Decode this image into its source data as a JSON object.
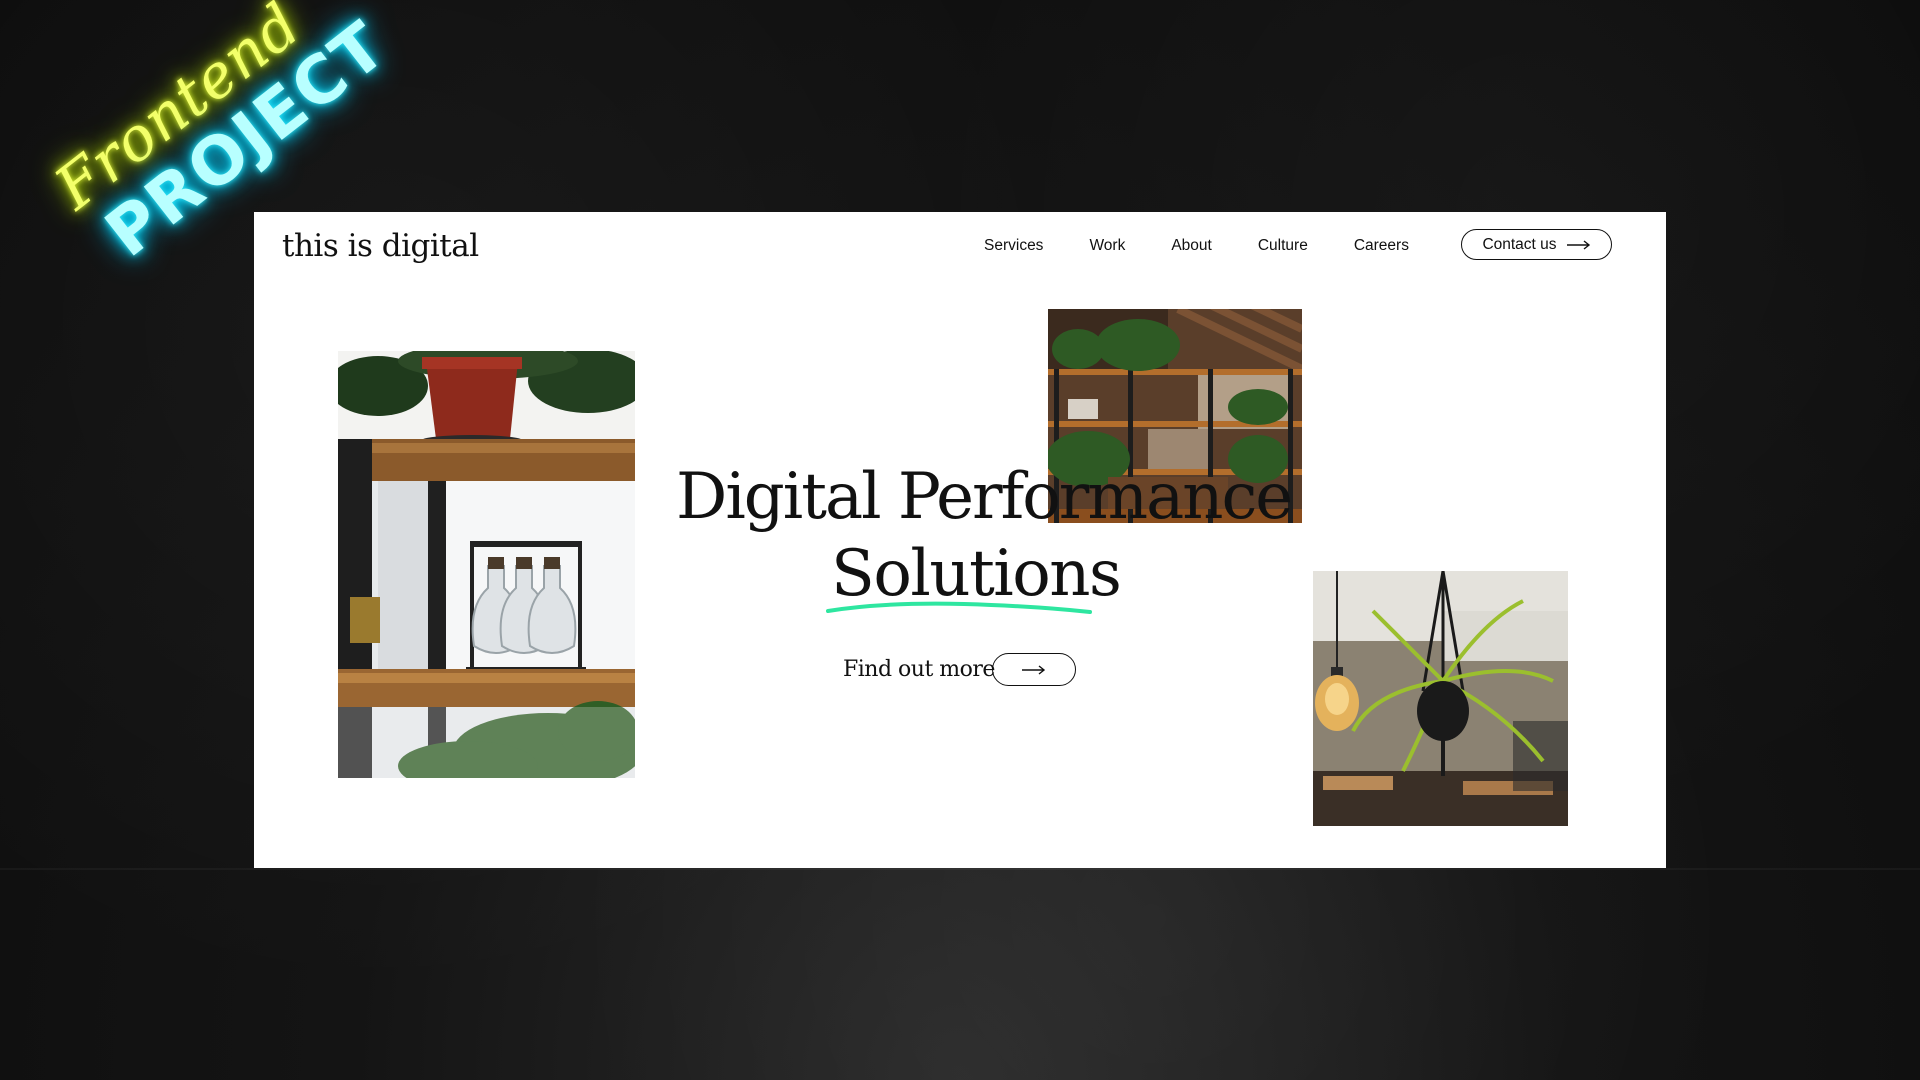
{
  "badge": {
    "line1": "Frontend",
    "line2": "PROJECT"
  },
  "site": {
    "logo": "this is digital",
    "nav": [
      {
        "label": "Services"
      },
      {
        "label": "Work"
      },
      {
        "label": "About"
      },
      {
        "label": "Culture"
      },
      {
        "label": "Careers"
      }
    ],
    "contact_label": "Contact us"
  },
  "hero": {
    "title_line1": "Digital Performance",
    "title_line2": "Solutions",
    "cta_label": "Find out more"
  },
  "colors": {
    "accent_underline": "#2ee6a0",
    "neon_yellow": "#f3ff6a",
    "neon_cyan": "#35f0ff"
  },
  "icons": [
    "arrow-right-icon"
  ]
}
